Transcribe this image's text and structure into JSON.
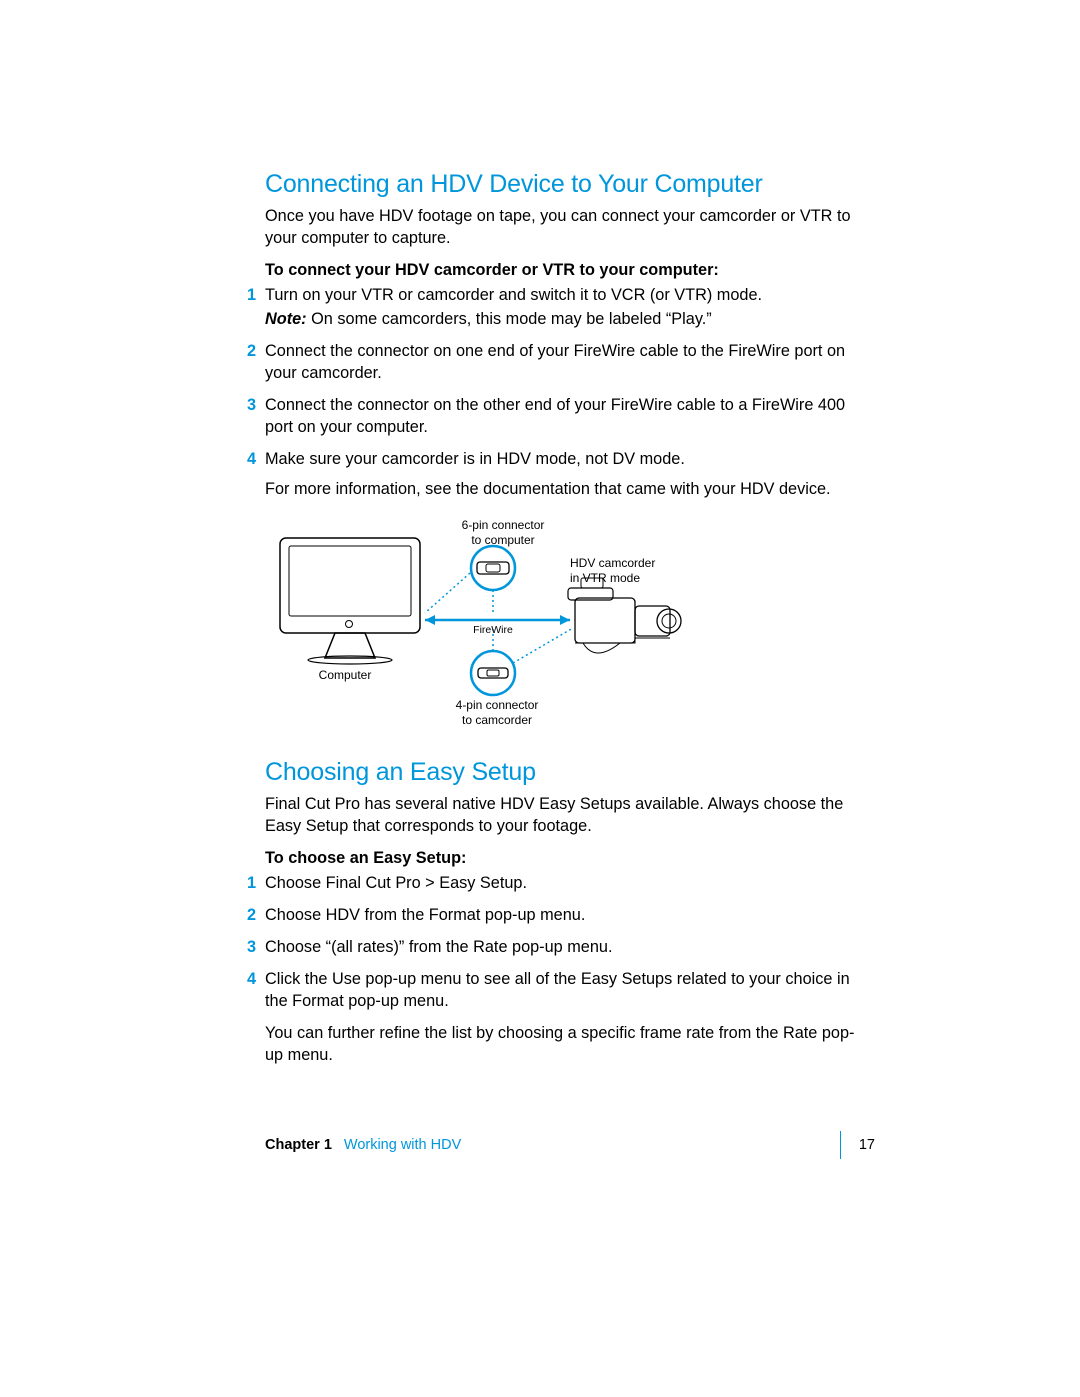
{
  "section1": {
    "heading": "Connecting an HDV Device to Your Computer",
    "intro": "Once you have HDV footage on tape, you can connect your camcorder or VTR to your computer to capture.",
    "proc_heading": "To connect your HDV camcorder or VTR to your computer:",
    "steps": {
      "s1": "Turn on your VTR or camcorder and switch it to VCR (or VTR) mode.",
      "note_lead": "Note:",
      "note_rest": "  On some camcorders, this mode may be labeled “Play.”",
      "s2": "Connect the connector on one end of your FireWire cable to the FireWire port on your camcorder.",
      "s3": "Connect the connector on the other end of your FireWire cable to a FireWire 400 port on your computer.",
      "s4": "Make sure your camcorder is in HDV mode, not DV mode.",
      "after4": "For more information, see the documentation that came with your HDV device."
    },
    "nums": {
      "n1": "1",
      "n2": "2",
      "n3": "3",
      "n4": "4"
    }
  },
  "diagram": {
    "label_6pin_a": "6-pin connector",
    "label_6pin_b": "to computer",
    "label_comp": "Computer",
    "label_fw": "FireWire",
    "label_cam_a": "HDV camcorder",
    "label_cam_b": "in VTR mode",
    "label_4pin_a": "4-pin connector",
    "label_4pin_b": "to camcorder"
  },
  "section2": {
    "heading": "Choosing an Easy Setup",
    "intro": "Final Cut Pro has several native HDV Easy Setups available. Always choose the Easy Setup that corresponds to your footage.",
    "proc_heading": "To choose an Easy Setup:",
    "steps": {
      "s1": "Choose Final Cut Pro > Easy Setup.",
      "s2": "Choose HDV from the Format pop-up menu.",
      "s3": "Choose “(all rates)” from the Rate pop-up menu.",
      "s4": "Click the Use pop-up menu to see all of the Easy Setups related to your choice in the Format pop-up menu.",
      "after4": "You can further refine the list by choosing a specific frame rate from the Rate pop-up menu."
    },
    "nums": {
      "n1": "1",
      "n2": "2",
      "n3": "3",
      "n4": "4"
    }
  },
  "footer": {
    "chapter_label": "Chapter 1",
    "chapter_title": "Working with HDV",
    "page_number": "17"
  }
}
